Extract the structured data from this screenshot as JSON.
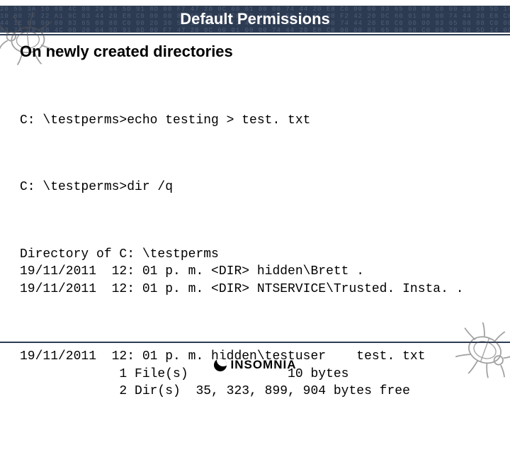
{
  "header": {
    "title": "Default Permissions",
    "hex_noise": "20 55 3A 10 8B 4C 00 20 64 5D 91 8D 00 F7 47 20 0C 60 01 00 00 74 44 20 E8 C0 00 00 83 65 08 88 C0 00 20 30 5D 14 0C 88 F2 42 20 0C 60 01 00 00 74 44 20 E8 C0 00 00 83\n10 60 7F 22 A1 9C 03 44 20 E8 C0 00 00 83 65 08 88 C0 00 20 30 5D 14 0C 88 F2 42 20 0C 60 01 00 00 74 44 20 E8 C0 00 00 83 65 08 88 C0 00 20 30 5D 14 0C 88 F2 42 00 74\n44 1E 08 00 00 83 65 08 88 C0 00 20 30 5D 14 0C 88 F2 42 20 0C 60 01 00 00 74 44 20 E8 C0 00 00 83 65 08 88 C0 00 20 30 5D 14 0C 88 F2 42 20 0C 60 01 00 00 74 44 20 E8\nB3 7A 10 8B 4C 00 20 64 5D 91 8D 00 F7 47 20 0C 60 01 00 00 74 44 20 E8 C0 00 00 83 65 08 88 C0 00 20 30 5D 14 0C 88 F2 42 20 0C 60 01 00 00 74 44 20 E8 C0 00 00 83 0C"
  },
  "section_heading": "On newly created directories",
  "terminal": {
    "cmd1": "C: \\testperms>echo testing > test. txt",
    "cmd2": "C: \\testperms>dir /q",
    "listing_header": "Directory of C: \\testperms",
    "row1": "19/11/2011  12: 01 p. m. <DIR> hidden\\Brett .",
    "row2": "19/11/2011  12: 01 p. m. <DIR> NTSERVICE\\Trusted. Insta. .",
    "row3": "19/11/2011  12: 01 p. m. hidden\\testuser    test. txt",
    "summary1": "             1 File(s)             10 bytes",
    "summary2": "             2 Dir(s)  35, 323, 899, 904 bytes free"
  },
  "footer": {
    "brand": "INSOMNIA"
  }
}
